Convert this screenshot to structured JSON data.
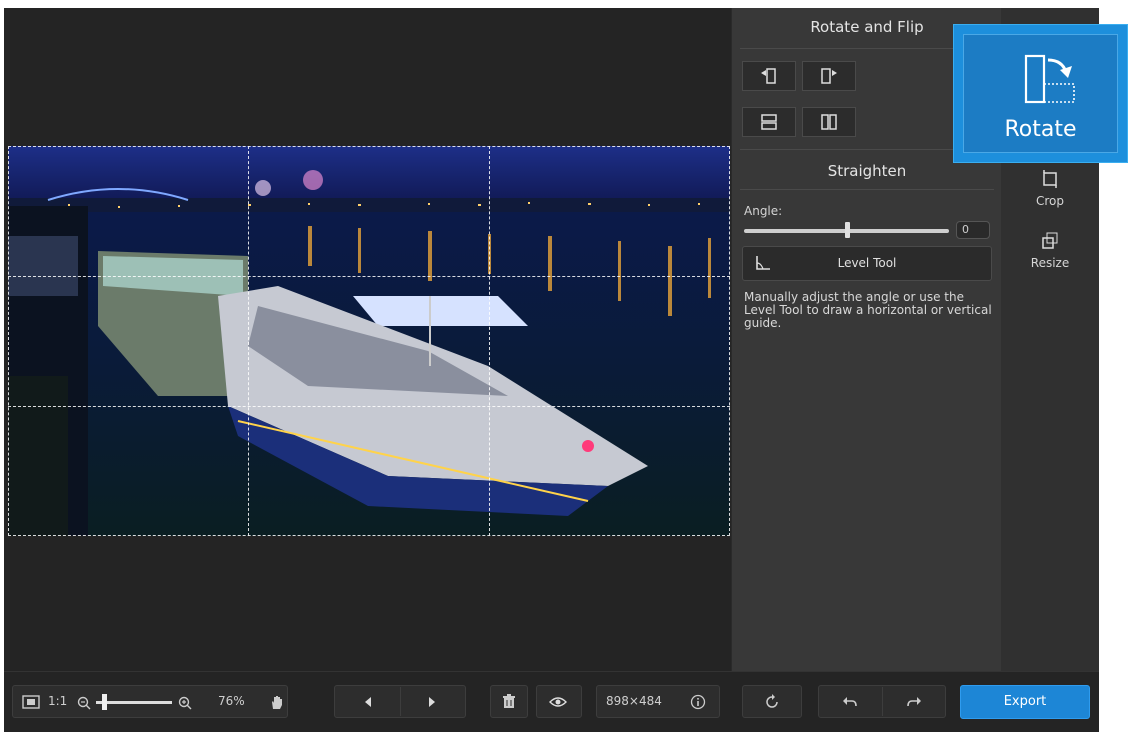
{
  "panel": {
    "title": "Rotate and Flip",
    "straighten_title": "Straighten",
    "angle_label": "Angle:",
    "angle_value": "0",
    "angle_fraction": 0.5,
    "level_tool_label": "Level Tool",
    "hint": "Manually adjust the angle or use the Level Tool to draw a horizontal or vertical guide."
  },
  "tools": {
    "crop_label": "Crop",
    "resize_label": "Resize"
  },
  "callout": {
    "label": "Rotate",
    "icon": "rotate-icon"
  },
  "bottombar": {
    "one_to_one": "1:1",
    "zoom_value": "76%",
    "zoom_fraction": 0.1,
    "dimensions": "898×484",
    "export_label": "Export"
  },
  "icons": {
    "fit": "fit-screen-icon",
    "zoom_out": "zoom-out-icon",
    "zoom_in": "zoom-in-icon",
    "hand": "hand-icon",
    "prev": "previous-icon",
    "next": "next-icon",
    "delete": "trash-icon",
    "preview": "eye-icon",
    "info": "info-icon",
    "reset": "reset-icon",
    "undo": "undo-icon",
    "redo": "redo-icon"
  },
  "colors": {
    "accent": "#1d86d6",
    "callout": "#1d8fdc",
    "panel": "#383838",
    "background": "#242424"
  }
}
